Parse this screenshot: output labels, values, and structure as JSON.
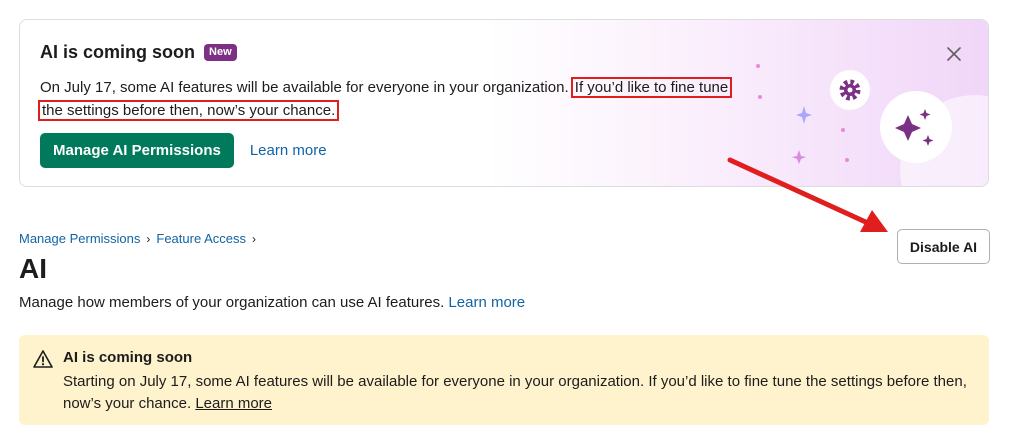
{
  "banner": {
    "title": "AI is coming soon",
    "badge": "New",
    "text_before": "On July 17, some AI features will be available for everyone in your organization.",
    "text_highlight_1": "If you’d like to fine tune",
    "text_highlight_2": "the settings before then, now’s your chance.",
    "primary_button": "Manage AI Permissions",
    "learn_more": "Learn more",
    "icons": [
      "close-icon",
      "gear-icon",
      "sparkles-icon"
    ],
    "accent_color": "#007a5a",
    "badge_color": "#7c3085",
    "highlight_color": "#e01e1e"
  },
  "breadcrumb": {
    "items": [
      "Manage Permissions",
      "Feature Access"
    ]
  },
  "page": {
    "title": "AI",
    "description": "Manage how members of your organization can use AI features.",
    "learn_more": "Learn more",
    "disable_button": "Disable AI"
  },
  "warning": {
    "title": "AI is coming soon",
    "text": "Starting on July 17, some AI features will be available for everyone in your organization. If you’d like to fine tune the settings before then, now’s your chance.",
    "learn_more": "Learn more",
    "icon": "warning-icon",
    "background_color": "#fef3cd"
  },
  "annotation": {
    "arrow_icon": "arrow-icon",
    "arrow_color": "#e01e1e"
  }
}
